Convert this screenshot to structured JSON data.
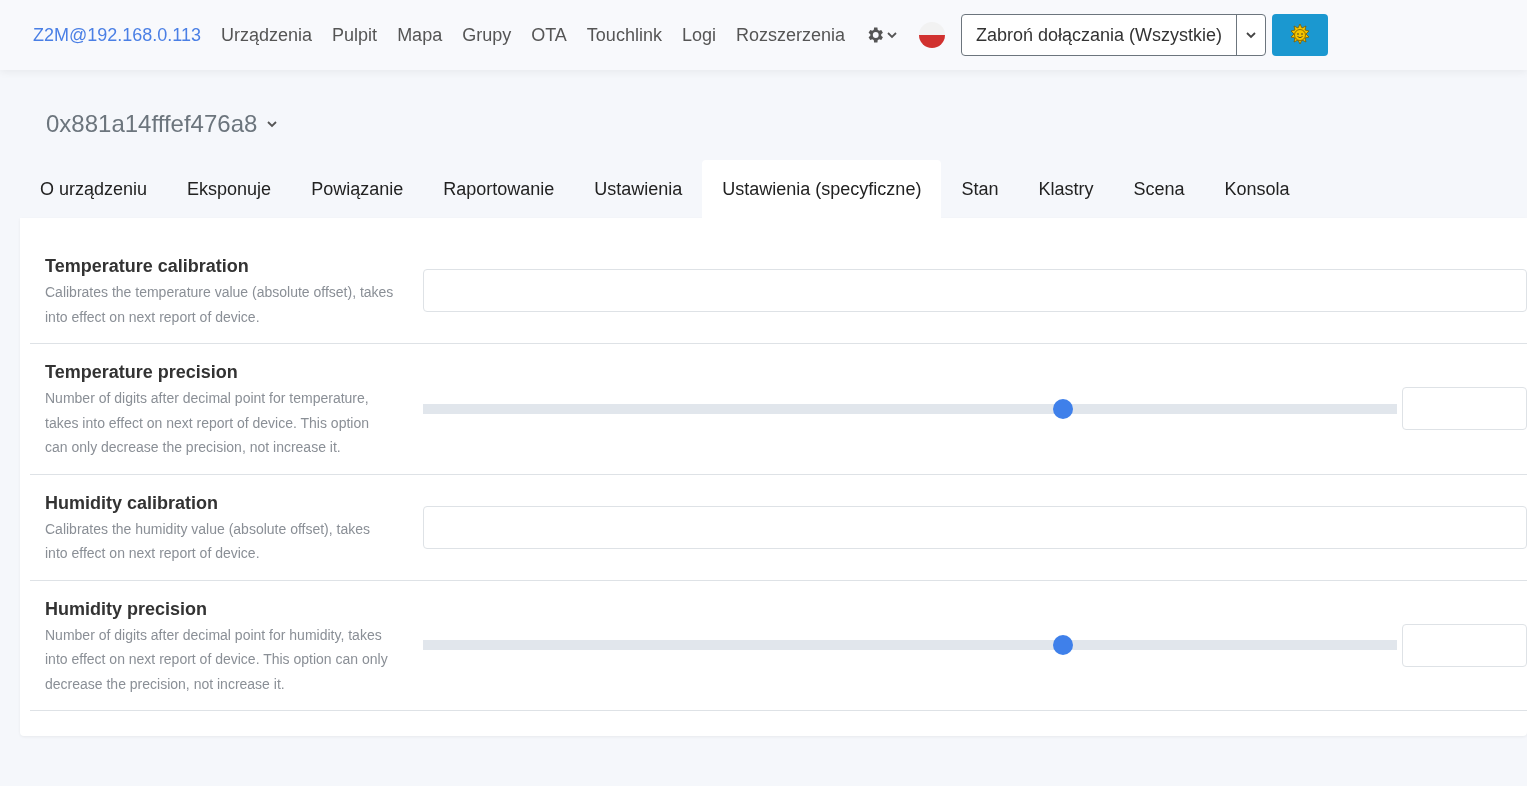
{
  "navbar": {
    "brand": "Z2M@192.168.0.113",
    "links": [
      "Urządzenia",
      "Pulpit",
      "Mapa",
      "Grupy",
      "OTA",
      "Touchlink",
      "Logi",
      "Rozszerzenia"
    ],
    "permit_join": "Zabroń dołączania (Wszystkie)"
  },
  "device": {
    "title": "0x881a14fffef476a8"
  },
  "tabs": [
    {
      "label": "O urządzeniu",
      "selected": false
    },
    {
      "label": "Eksponuje",
      "selected": false
    },
    {
      "label": "Powiązanie",
      "selected": false
    },
    {
      "label": "Raportowanie",
      "selected": false
    },
    {
      "label": "Ustawienia",
      "selected": false
    },
    {
      "label": "Ustawienia (specyficzne)",
      "selected": true
    },
    {
      "label": "Stan",
      "selected": false
    },
    {
      "label": "Klastry",
      "selected": false
    },
    {
      "label": "Scena",
      "selected": false
    },
    {
      "label": "Konsola",
      "selected": false
    }
  ],
  "settings": [
    {
      "kind": "input",
      "title": "Temperature calibration",
      "description": "Calibrates the temperature value (absolute offset), takes into effect on next report of device."
    },
    {
      "kind": "slider",
      "title": "Temperature precision",
      "description": "Number of digits after decimal point for temperature, takes into effect on next report of device. This option can only decrease the precision, not increase it.",
      "level": 0.66
    },
    {
      "kind": "input",
      "title": "Humidity calibration",
      "description": "Calibrates the humidity value (absolute offset), takes into effect on next report of device."
    },
    {
      "kind": "slider",
      "title": "Humidity precision",
      "description": "Number of digits after decimal point for humidity, takes into effect on next report of device. This option can only decrease the precision, not increase it.",
      "level": 0.66
    }
  ]
}
